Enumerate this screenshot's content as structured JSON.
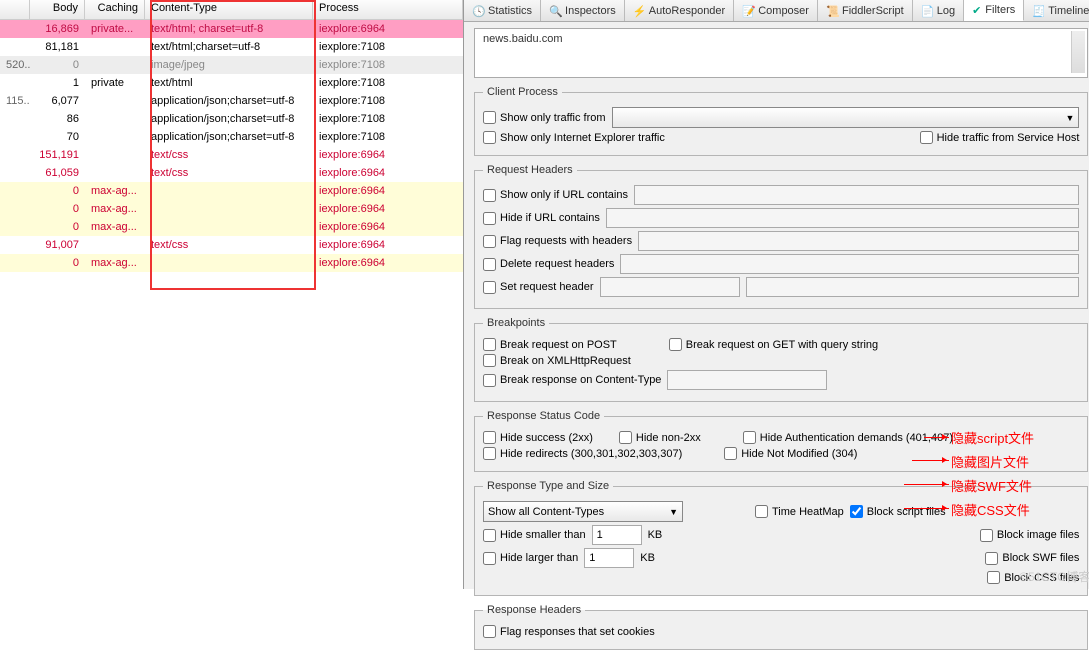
{
  "grid": {
    "headers": {
      "body": "Body",
      "caching": "Caching",
      "ct": "Content-Type",
      "proc": "Process"
    },
    "rows": [
      {
        "pre": "",
        "body": "16,869",
        "cache": "private...",
        "ct": "text/html; charset=utf-8",
        "proc": "iexplore:6964",
        "cls": "pink"
      },
      {
        "pre": "",
        "body": "81,181",
        "cache": "",
        "ct": "text/html;charset=utf-8",
        "proc": "iexplore:7108",
        "cls": ""
      },
      {
        "pre": "520...",
        "body": "0",
        "cache": "",
        "ct": "image/jpeg",
        "proc": "iexplore:7108",
        "cls": "gray"
      },
      {
        "pre": "",
        "body": "1",
        "cache": "private",
        "ct": "text/html",
        "proc": "iexplore:7108",
        "cls": ""
      },
      {
        "pre": "115...",
        "body": "6,077",
        "cache": "",
        "ct": "application/json;charset=utf-8",
        "proc": "iexplore:7108",
        "cls": ""
      },
      {
        "pre": "",
        "body": "86",
        "cache": "",
        "ct": "application/json;charset=utf-8",
        "proc": "iexplore:7108",
        "cls": ""
      },
      {
        "pre": "",
        "body": "70",
        "cache": "",
        "ct": "application/json;charset=utf-8",
        "proc": "iexplore:7108",
        "cls": ""
      },
      {
        "pre": "",
        "body": "151,191",
        "cache": "",
        "ct": "text/css",
        "proc": "iexplore:6964",
        "cls": "red"
      },
      {
        "pre": "",
        "body": "61,059",
        "cache": "",
        "ct": "text/css",
        "proc": "iexplore:6964",
        "cls": "red"
      },
      {
        "pre": "",
        "body": "0",
        "cache": "max-ag...",
        "ct": "",
        "proc": "iexplore:6964",
        "cls": "yel"
      },
      {
        "pre": "",
        "body": "0",
        "cache": "max-ag...",
        "ct": "",
        "proc": "iexplore:6964",
        "cls": "yel"
      },
      {
        "pre": "",
        "body": "0",
        "cache": "max-ag...",
        "ct": "",
        "proc": "iexplore:6964",
        "cls": "yel"
      },
      {
        "pre": "",
        "body": "91,007",
        "cache": "",
        "ct": "text/css",
        "proc": "iexplore:6964",
        "cls": "red"
      },
      {
        "pre": "",
        "body": "0",
        "cache": "max-ag...",
        "ct": "",
        "proc": "iexplore:6964",
        "cls": "yel"
      }
    ]
  },
  "tabs": {
    "stats": "Statistics",
    "insp": "Inspectors",
    "auto": "AutoResponder",
    "comp": "Composer",
    "fs": "FiddlerScript",
    "log": "Log",
    "filt": "Filters",
    "tl": "Timeline"
  },
  "host": "news.baidu.com",
  "cp": {
    "legend": "Client Process",
    "only": "Show only traffic from",
    "ie": "Show only Internet Explorer traffic",
    "hide": "Hide traffic from Service Host"
  },
  "rh": {
    "legend": "Request Headers",
    "url": "Show only if URL contains",
    "hide": "Hide if URL contains",
    "flag": "Flag requests with headers",
    "del": "Delete request headers",
    "set": "Set request header"
  },
  "bp": {
    "legend": "Breakpoints",
    "post": "Break request on POST",
    "get": "Break request on GET with query string",
    "xhr": "Break on XMLHttpRequest",
    "ct": "Break response on Content-Type"
  },
  "sc": {
    "legend": "Response Status Code",
    "s2": "Hide success (2xx)",
    "n2": "Hide non-2xx",
    "auth": "Hide Authentication demands (401,407)",
    "red": "Hide redirects (300,301,302,303,307)",
    "nm": "Hide Not Modified (304)"
  },
  "ts": {
    "legend": "Response Type and Size",
    "combo": "Show all Content-Types",
    "hs": "Hide smaller than",
    "hl": "Hide larger than",
    "sp1": "1",
    "sp2": "1",
    "kb": "KB",
    "thm": "Time HeatMap",
    "bsc": "Block script files",
    "bim": "Block image files",
    "bsw": "Block SWF files",
    "bcs": "Block CSS files"
  },
  "rhd": {
    "legend": "Response Headers",
    "flag": "Flag responses that set cookies"
  },
  "ann": {
    "a1": "隐藏script文件",
    "a2": "隐藏图片文件",
    "a3": "隐藏SWF文件",
    "a4": "隐藏CSS文件"
  },
  "wm": "©51CTO博客"
}
